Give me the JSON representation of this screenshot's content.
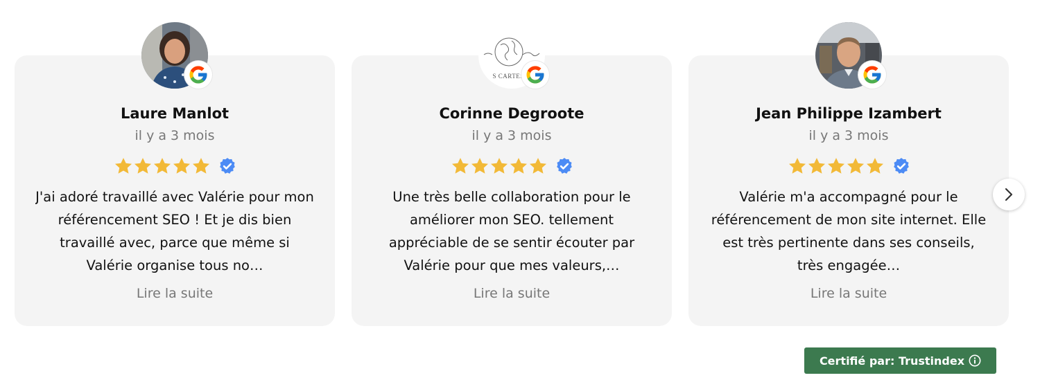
{
  "reviews": [
    {
      "name": "Laure Manlot",
      "date": "il y a 3 mois",
      "rating": 5,
      "text": "J'ai adoré travaillé avec Valérie pour mon référencement SEO ! Et je dis bien travaillé avec, parce que même si Valérie organise tous no…",
      "more_label": "Lire la suite",
      "avatar_icon": "photo-avatar-woman",
      "source_icon": "google-g-icon"
    },
    {
      "name": "Corinne Degroote",
      "date": "il y a 3 mois",
      "rating": 5,
      "text": "Une très belle collaboration pour le améliorer mon SEO. tellement appréciable de se sentir écouter par Valérie pour que mes valeurs,…",
      "more_label": "Lire la suite",
      "avatar_icon": "globe-logo-avatar",
      "avatar_logo_text": "S CARTES D",
      "source_icon": "google-g-icon"
    },
    {
      "name": "Jean Philippe Izambert",
      "date": "il y a 3 mois",
      "rating": 5,
      "text": "Valérie m'a accompagné pour le référencement de mon site internet. Elle est très pertinente dans ses conseils, très engagée…",
      "more_label": "Lire la suite",
      "avatar_icon": "photo-avatar-man",
      "source_icon": "google-g-icon"
    }
  ],
  "certified_label": "Certifié par: Trustindex",
  "colors": {
    "star": "#f2b937",
    "verified": "#4c8bf5",
    "badge_bg": "#3c7a4f",
    "card_bg": "#f4f4f4"
  }
}
